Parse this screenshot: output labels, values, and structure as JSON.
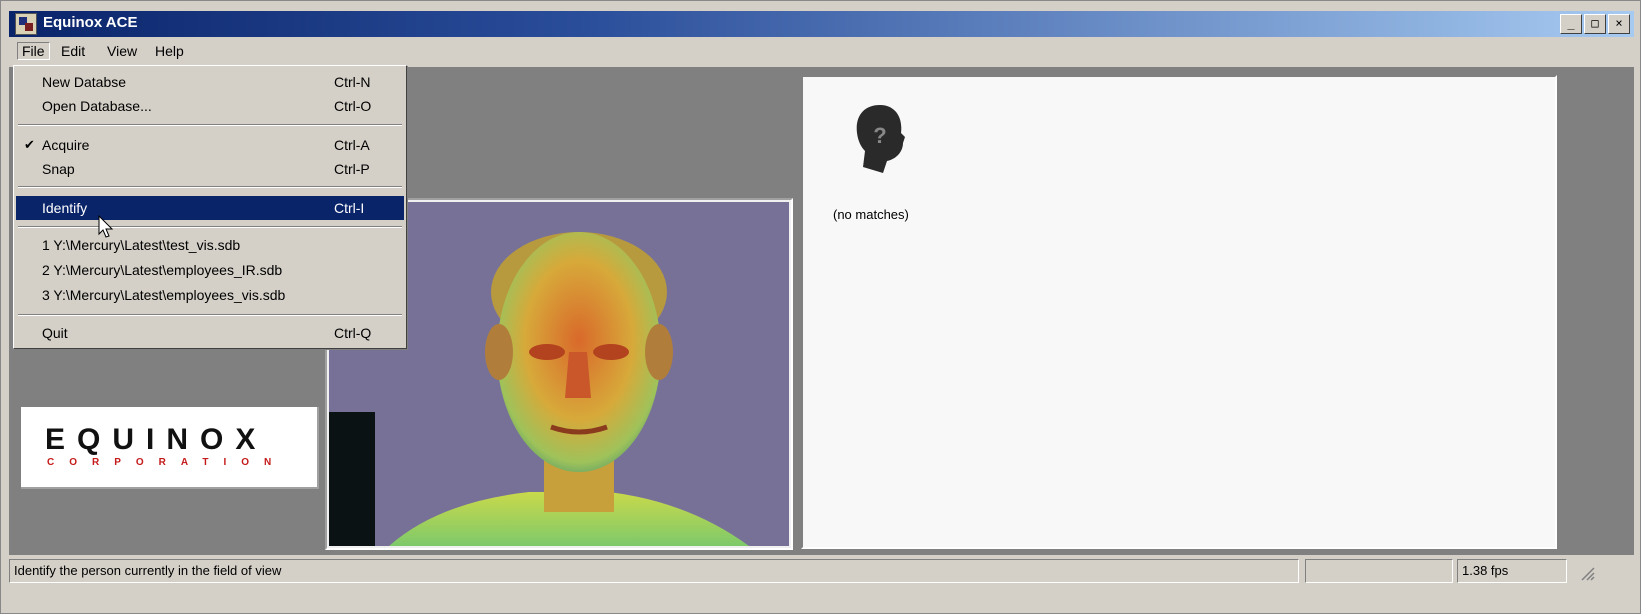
{
  "window": {
    "title": "Equinox ACE",
    "controls": [
      "_",
      "□",
      "×"
    ]
  },
  "menubar": [
    "File",
    "Edit",
    "View",
    "Help"
  ],
  "file_menu": {
    "items": [
      {
        "label": "New Databse",
        "shortcut": "Ctrl-N"
      },
      {
        "label": "Open Database...",
        "shortcut": "Ctrl-O"
      },
      {
        "label": "Acquire",
        "shortcut": "Ctrl-A",
        "checked": true
      },
      {
        "label": "Snap",
        "shortcut": "Ctrl-P"
      },
      {
        "label": "Identify",
        "shortcut": "Ctrl-I",
        "highlighted": true
      },
      {
        "label": "1 Y:\\Mercury\\Latest\\test_vis.sdb"
      },
      {
        "label": "2 Y:\\Mercury\\Latest\\employees_IR.sdb"
      },
      {
        "label": "3 Y:\\Mercury\\Latest\\employees_vis.sdb"
      },
      {
        "label": "Quit",
        "shortcut": "Ctrl-Q"
      }
    ],
    "check_mark": "✔"
  },
  "logo": {
    "name": "EQUINOX",
    "sub": "CORPORATION"
  },
  "results": {
    "no_matches": "(no matches)",
    "icon": "unknown-person-icon"
  },
  "status": {
    "message": "Identify the person currently in the field of view",
    "fps": "1.38 fps"
  },
  "colors": {
    "menu_highlight": "#0a246a",
    "titlebar_start": "#0a246a",
    "titlebar_end": "#a6caf0",
    "logo_red": "#c41a1a"
  }
}
